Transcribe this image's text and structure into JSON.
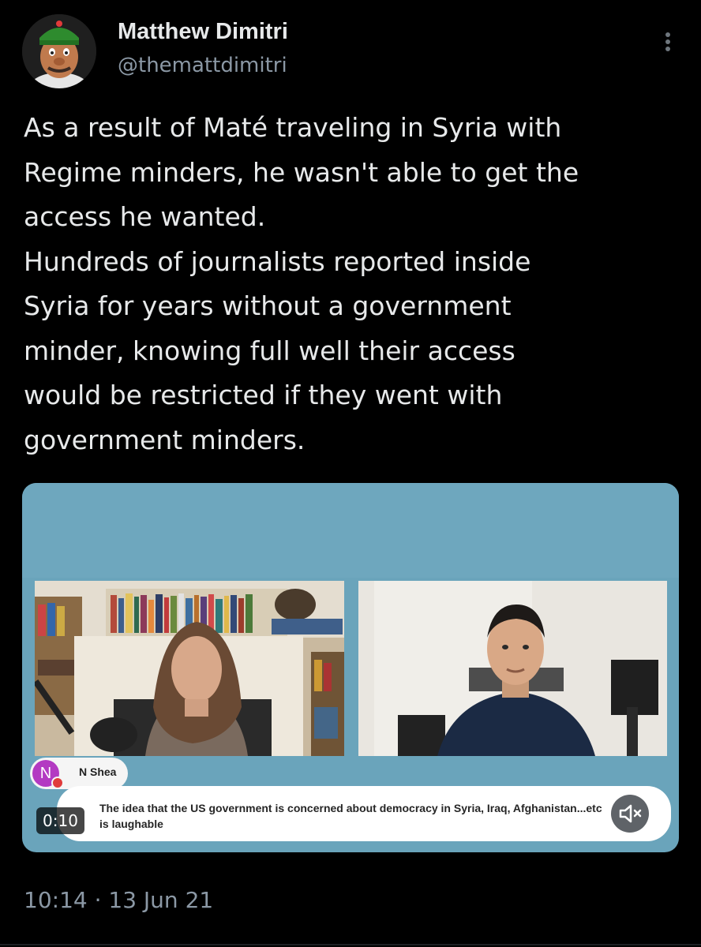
{
  "author": {
    "name": "Matthew Dimitri",
    "handle": "@themattdimitri",
    "avatar_icon": "cartoon-avatar-icon"
  },
  "tweet": {
    "text": "As a result of Maté traveling in Syria with\nRegime minders, he wasn't able to get the\naccess he wanted.\nHundreds of journalists reported inside\nSyria for years without a government\nminder, knowing full well their access\nwould be restricted if they went with\ngovernment minders.",
    "timestamp": "10:14 · 13 Jun 21"
  },
  "video": {
    "speaker_initial": "N",
    "speaker_name": "N Shea",
    "caption": "The idea that the US government is concerned about democracy in Syria, Iraq, Afghanistan...etc is laughable",
    "elapsed": "0:10",
    "mute_icon": "speaker-muted-icon",
    "background_color": "#6aa4bb"
  },
  "menu": {
    "icon": "more-vertical-icon"
  }
}
